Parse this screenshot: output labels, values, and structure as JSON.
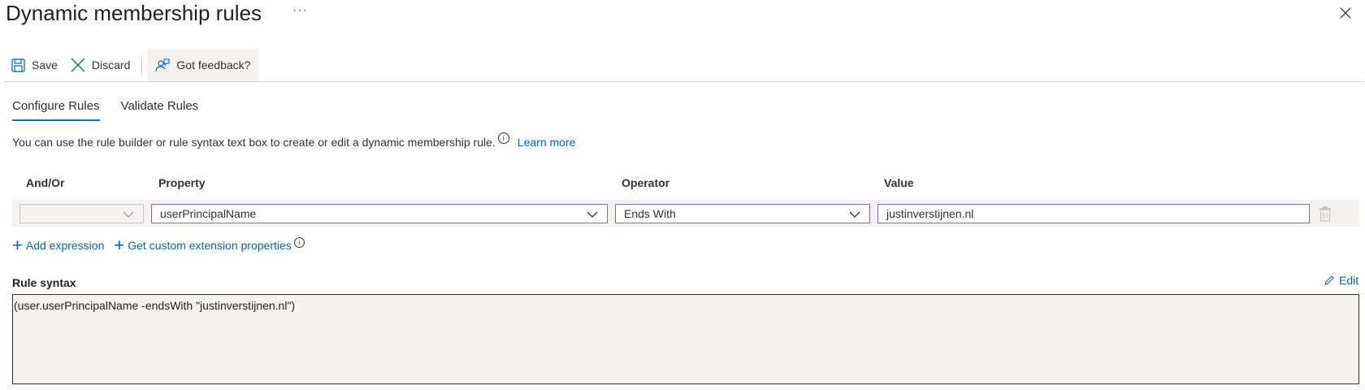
{
  "page": {
    "title": "Dynamic membership rules",
    "more_label": "···"
  },
  "toolbar": {
    "save_label": "Save",
    "discard_label": "Discard",
    "feedback_label": "Got feedback?"
  },
  "tabs": [
    {
      "label": "Configure Rules",
      "active": true
    },
    {
      "label": "Validate Rules",
      "active": false
    }
  ],
  "info": {
    "text": "You can use the rule builder or rule syntax text box to create or edit a dynamic membership rule.",
    "link": "Learn more"
  },
  "rule_table": {
    "headers": [
      "And/Or",
      "Property",
      "Operator",
      "Value"
    ],
    "rows": [
      {
        "and_or": "",
        "property": "userPrincipalName",
        "operator": "Ends With",
        "value": "justinverstijnen.nl"
      }
    ]
  },
  "actions": {
    "add_expression": "Add expression",
    "custom_extension": "Get custom extension properties"
  },
  "rule_syntax": {
    "label": "Rule syntax",
    "edit_label": "Edit",
    "text": "(user.userPrincipalName -endsWith \"justinverstijnen.nl\")"
  },
  "colors": {
    "accent": "#0078d4",
    "link": "#0067b8",
    "focus_border": "#8764b8"
  },
  "icons": [
    "save-icon",
    "discard-icon",
    "feedback-icon",
    "close-icon",
    "info-icon",
    "chevron-down-icon",
    "trash-icon",
    "plus-icon",
    "pencil-icon"
  ]
}
